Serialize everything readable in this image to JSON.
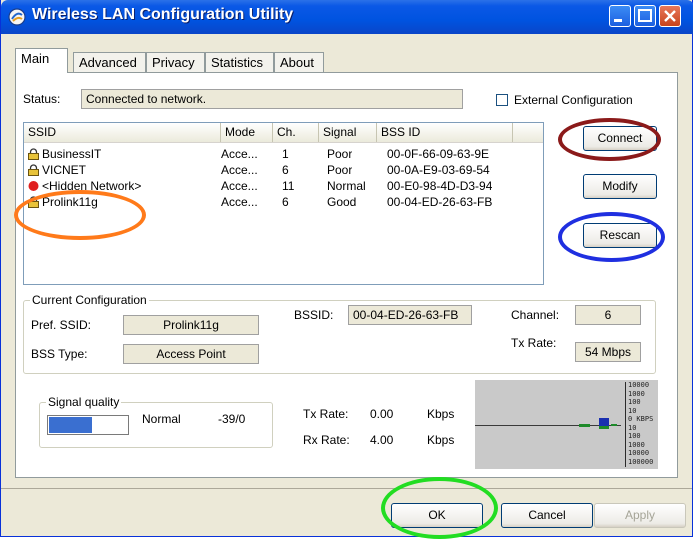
{
  "window": {
    "title": "Wireless LAN Configuration Utility",
    "title_bar_color": "#0053e0"
  },
  "tabs": [
    "Main",
    "Advanced",
    "Privacy",
    "Statistics",
    "About"
  ],
  "status": {
    "label": "Status:",
    "value": "Connected to network."
  },
  "external_config": {
    "label": "External Configuration",
    "checked": false
  },
  "network_list": {
    "columns": [
      "SSID",
      "Mode",
      "Ch.",
      "Signal",
      "BSS ID"
    ],
    "rows": [
      {
        "icon": "lock-icon",
        "ssid": "BusinessIT",
        "mode": "Acce...",
        "ch": "1",
        "signal": "Poor",
        "bssid": "00-0F-66-09-63-9E"
      },
      {
        "icon": "lock-icon",
        "ssid": "VICNET",
        "mode": "Acce...",
        "ch": "6",
        "signal": "Poor",
        "bssid": "00-0A-E9-03-69-54"
      },
      {
        "icon": "red-dot-icon",
        "ssid": "<Hidden Network>",
        "mode": "Acce...",
        "ch": "11",
        "signal": "Normal",
        "bssid": "00-E0-98-4D-D3-94"
      },
      {
        "icon": "lock-icon",
        "ssid": "Prolink11g",
        "mode": "Acce...",
        "ch": "6",
        "signal": "Good",
        "bssid": "00-04-ED-26-63-FB"
      }
    ]
  },
  "buttons": {
    "connect": "Connect",
    "modify": "Modify",
    "rescan": "Rescan",
    "ok": "OK",
    "cancel": "Cancel",
    "apply": "Apply"
  },
  "current_config": {
    "title": "Current Configuration",
    "pref_ssid_label": "Pref. SSID:",
    "pref_ssid": "Prolink11g",
    "bss_type_label": "BSS Type:",
    "bss_type": "Access Point",
    "bssid_label": "BSSID:",
    "bssid": "00-04-ED-26-63-FB",
    "channel_label": "Channel:",
    "channel": "6",
    "tx_rate_label": "Tx Rate:",
    "tx_rate": "54 Mbps"
  },
  "signal": {
    "title": "Signal quality",
    "quality_text": "Normal",
    "level": "-39/0",
    "quality_fraction": 0.55
  },
  "throughput": {
    "tx_label": "Tx Rate:",
    "tx_value": "0.00",
    "rx_label": "Rx Rate:",
    "rx_value": "4.00",
    "unit": "Kbps",
    "scale_labels": [
      "10000",
      "1000",
      "100",
      "10",
      "0 KBPS",
      "10",
      "100",
      "1000",
      "10000",
      "100000"
    ]
  },
  "annotations": {
    "connect_color": "#8b1a1a",
    "rescan_color": "#1f2fe0",
    "prolink_color": "#ff7a1a",
    "ok_color": "#22dd22"
  }
}
